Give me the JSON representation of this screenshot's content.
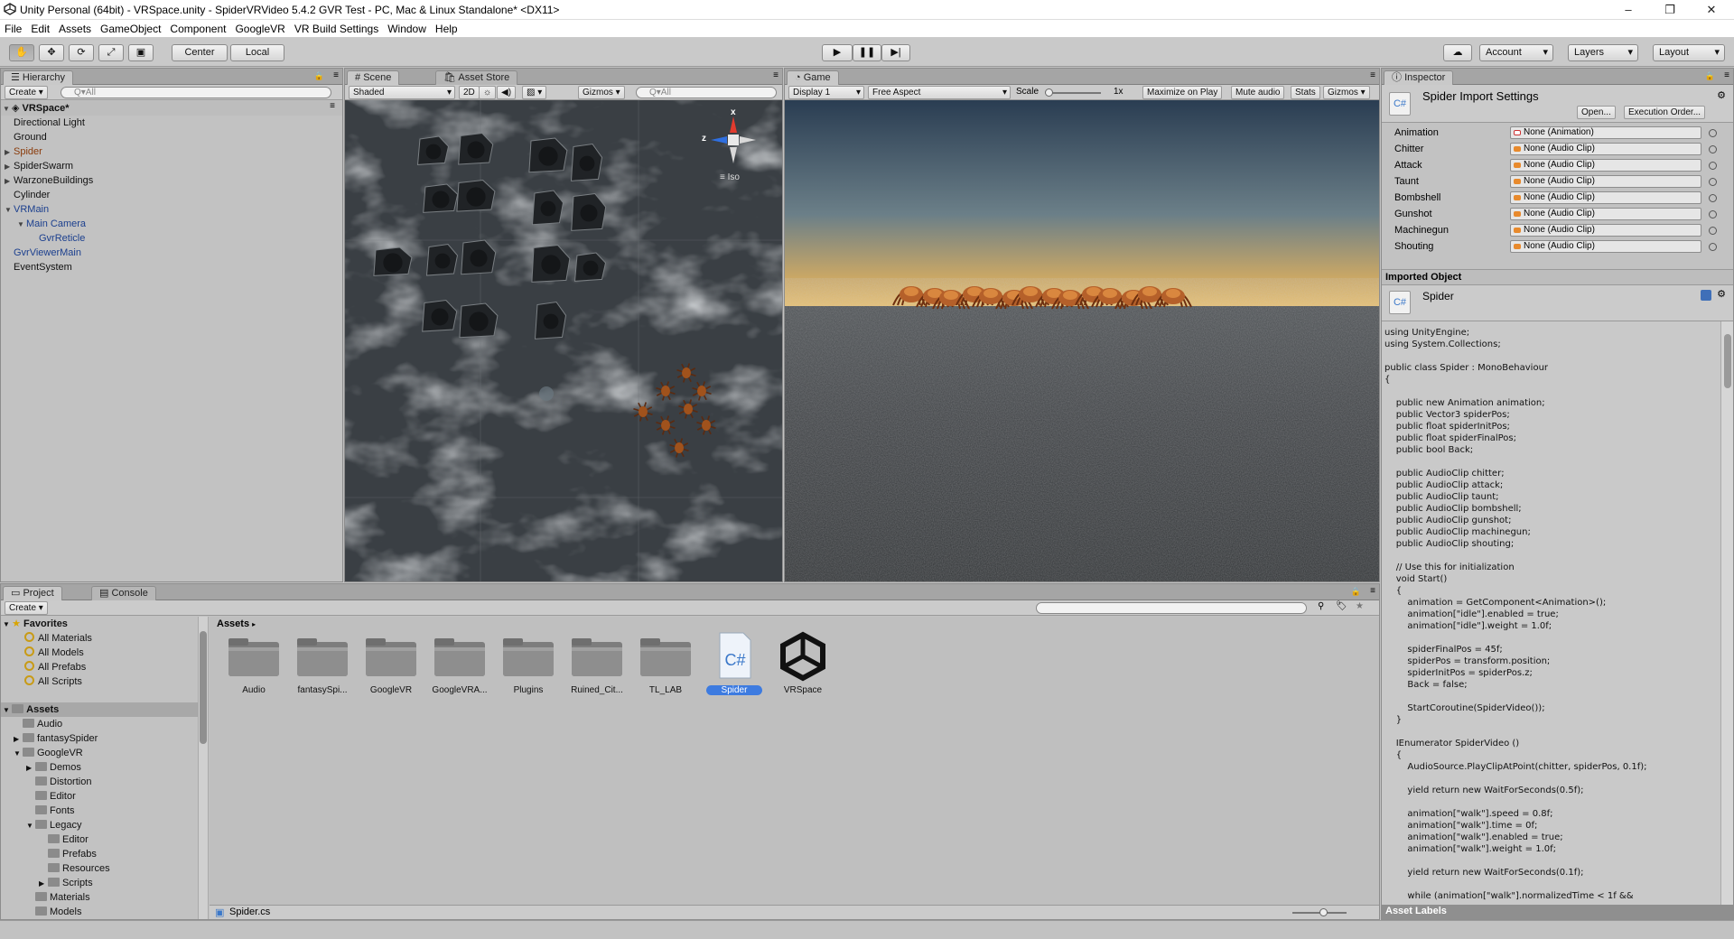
{
  "window": {
    "title": "Unity Personal (64bit) - VRSpace.unity - SpiderVRVideo 5.4.2 GVR Test - PC, Mac & Linux Standalone* <DX11>",
    "minimize": "–",
    "maximize": "❐",
    "close": "✕"
  },
  "menu": [
    "File",
    "Edit",
    "Assets",
    "GameObject",
    "Component",
    "GoogleVR",
    "VR Build Settings",
    "Window",
    "Help"
  ],
  "toolbar": {
    "pivot": "Center",
    "space": "Local",
    "account": "Account",
    "layers": "Layers",
    "layout": "Layout"
  },
  "hierarchy": {
    "tab": "Hierarchy",
    "create": "Create",
    "search_placeholder": "Q▾All",
    "scene": "VRSpace*",
    "items": [
      {
        "label": "Directional Light",
        "indent": 1,
        "arrow": "",
        "color": "normal"
      },
      {
        "label": "Ground",
        "indent": 1,
        "arrow": "",
        "color": "normal"
      },
      {
        "label": "Spider",
        "indent": 1,
        "arrow": "▶",
        "color": "orange"
      },
      {
        "label": "SpiderSwarm",
        "indent": 1,
        "arrow": "▶",
        "color": "normal"
      },
      {
        "label": "WarzoneBuildings",
        "indent": 1,
        "arrow": "▶",
        "color": "normal"
      },
      {
        "label": "Cylinder",
        "indent": 1,
        "arrow": "",
        "color": "normal"
      },
      {
        "label": "VRMain",
        "indent": 1,
        "arrow": "▼",
        "color": "blue"
      },
      {
        "label": "Main Camera",
        "indent": 2,
        "arrow": "▼",
        "color": "blue"
      },
      {
        "label": "GvrReticle",
        "indent": 3,
        "arrow": "",
        "color": "blue"
      },
      {
        "label": "GvrViewerMain",
        "indent": 1,
        "arrow": "",
        "color": "blue"
      },
      {
        "label": "EventSystem",
        "indent": 1,
        "arrow": "",
        "color": "normal"
      }
    ]
  },
  "scene": {
    "tab": "Scene",
    "tab2": "Asset Store",
    "shading": "Shaded",
    "mode2d": "2D",
    "gizmos": "Gizmos",
    "search_placeholder": "Q▾All",
    "gizmo_x": "x",
    "gizmo_z": "z",
    "iso": "Iso"
  },
  "game": {
    "tab": "Game",
    "display": "Display 1",
    "aspect": "Free Aspect",
    "scale_label": "Scale",
    "scale_value": "1x",
    "maximize": "Maximize on Play",
    "mute": "Mute audio",
    "stats": "Stats",
    "gizmos": "Gizmos"
  },
  "inspector": {
    "tab": "Inspector",
    "title": "Spider Import Settings",
    "open": "Open...",
    "exec_order": "Execution Order...",
    "fields": [
      {
        "label": "Animation",
        "value": "None (Animation)"
      },
      {
        "label": "Chitter",
        "value": "None (Audio Clip)"
      },
      {
        "label": "Attack",
        "value": "None (Audio Clip)"
      },
      {
        "label": "Taunt",
        "value": "None (Audio Clip)"
      },
      {
        "label": "Bombshell",
        "value": "None (Audio Clip)"
      },
      {
        "label": "Gunshot",
        "value": "None (Audio Clip)"
      },
      {
        "label": "Machinegun",
        "value": "None (Audio Clip)"
      },
      {
        "label": "Shouting",
        "value": "None (Audio Clip)"
      }
    ],
    "imported_header": "Imported Object",
    "imported_name": "Spider",
    "code": "using UnityEngine;\nusing System.Collections;\n\npublic class Spider : MonoBehaviour\n{\n\n    public new Animation animation;\n    public Vector3 spiderPos;\n    public float spiderInitPos;\n    public float spiderFinalPos;\n    public bool Back;\n\n    public AudioClip chitter;\n    public AudioClip attack;\n    public AudioClip taunt;\n    public AudioClip bombshell;\n    public AudioClip gunshot;\n    public AudioClip machinegun;\n    public AudioClip shouting;\n\n    // Use this for initialization\n    void Start()\n    {\n        animation = GetComponent<Animation>();\n        animation[\"idle\"].enabled = true;\n        animation[\"idle\"].weight = 1.0f;\n\n        spiderFinalPos = 45f;\n        spiderPos = transform.position;\n        spiderInitPos = spiderPos.z;\n        Back = false;\n\n        StartCoroutine(SpiderVideo());\n    }\n\n    IEnumerator SpiderVideo ()\n    {\n        AudioSource.PlayClipAtPoint(chitter, spiderPos, 0.1f);\n\n        yield return new WaitForSeconds(0.5f);\n\n        animation[\"walk\"].speed = 0.8f;\n        animation[\"walk\"].time = 0f;\n        animation[\"walk\"].enabled = true;\n        animation[\"walk\"].weight = 1.0f;\n\n        yield return new WaitForSeconds(0.1f);\n\n        while (animation[\"walk\"].normalizedTime < 1f &&",
    "asset_labels": "Asset Labels"
  },
  "project": {
    "tab": "Project",
    "tab2": "Console",
    "create": "Create",
    "favorites_header": "Favorites",
    "favorites": [
      "All Materials",
      "All Models",
      "All Prefabs",
      "All Scripts"
    ],
    "assets_header": "Assets",
    "tree": [
      {
        "label": "Audio",
        "indent": 1,
        "arrow": ""
      },
      {
        "label": "fantasySpider",
        "indent": 1,
        "arrow": "▶"
      },
      {
        "label": "GoogleVR",
        "indent": 1,
        "arrow": "▼"
      },
      {
        "label": "Demos",
        "indent": 2,
        "arrow": "▶"
      },
      {
        "label": "Distortion",
        "indent": 2,
        "arrow": ""
      },
      {
        "label": "Editor",
        "indent": 2,
        "arrow": ""
      },
      {
        "label": "Fonts",
        "indent": 2,
        "arrow": ""
      },
      {
        "label": "Legacy",
        "indent": 2,
        "arrow": "▼"
      },
      {
        "label": "Editor",
        "indent": 3,
        "arrow": ""
      },
      {
        "label": "Prefabs",
        "indent": 3,
        "arrow": ""
      },
      {
        "label": "Resources",
        "indent": 3,
        "arrow": ""
      },
      {
        "label": "Scripts",
        "indent": 3,
        "arrow": "▶"
      },
      {
        "label": "Materials",
        "indent": 2,
        "arrow": ""
      },
      {
        "label": "Models",
        "indent": 2,
        "arrow": ""
      }
    ],
    "breadcrumb": "Assets",
    "assets": [
      {
        "label": "Audio",
        "kind": "folder"
      },
      {
        "label": "fantasySpi...",
        "kind": "folder"
      },
      {
        "label": "GoogleVR",
        "kind": "folder"
      },
      {
        "label": "GoogleVRA...",
        "kind": "folder"
      },
      {
        "label": "Plugins",
        "kind": "folder"
      },
      {
        "label": "Ruined_Cit...",
        "kind": "folder"
      },
      {
        "label": "TL_LAB",
        "kind": "folder"
      },
      {
        "label": "Spider",
        "kind": "script"
      },
      {
        "label": "VRSpace",
        "kind": "unity"
      }
    ],
    "status_file": "Spider.cs"
  },
  "colors": {
    "selection": "#3d7be0",
    "hierarchy_blue": "#1b3f8e",
    "prefab_orange": "#8a3b0a"
  }
}
